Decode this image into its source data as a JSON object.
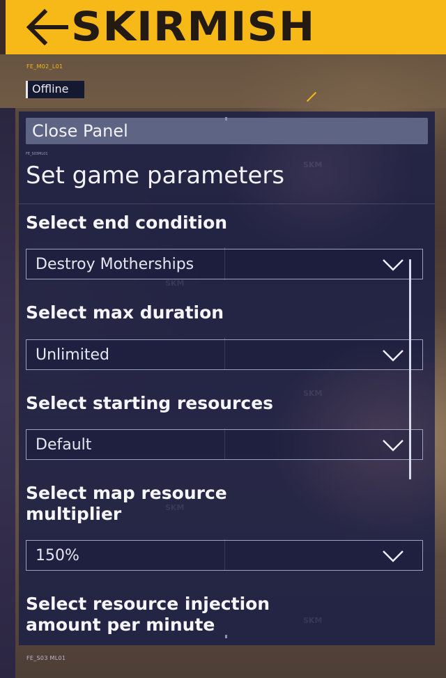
{
  "header": {
    "title": "SKIRMISH",
    "back_icon": "arrow-left-icon",
    "accent_color": "#f6b918",
    "code": "FE_M02_L01"
  },
  "status": {
    "label": "Offline"
  },
  "panel": {
    "close_label": "Close Panel",
    "code": "FE_S03ML01",
    "title": "Set game parameters",
    "sections": [
      {
        "label": "Select end condition",
        "value": "Destroy Motherships"
      },
      {
        "label": "Select max duration",
        "value": "Unlimited"
      },
      {
        "label": "Select starting resources",
        "value": "Default"
      },
      {
        "label": "Select map resource multiplier",
        "value": "150%"
      },
      {
        "label": "Select resource injection amount per minute"
      }
    ]
  },
  "watermark": "SKM",
  "footer": {
    "code": "FE_S03 ML01"
  }
}
